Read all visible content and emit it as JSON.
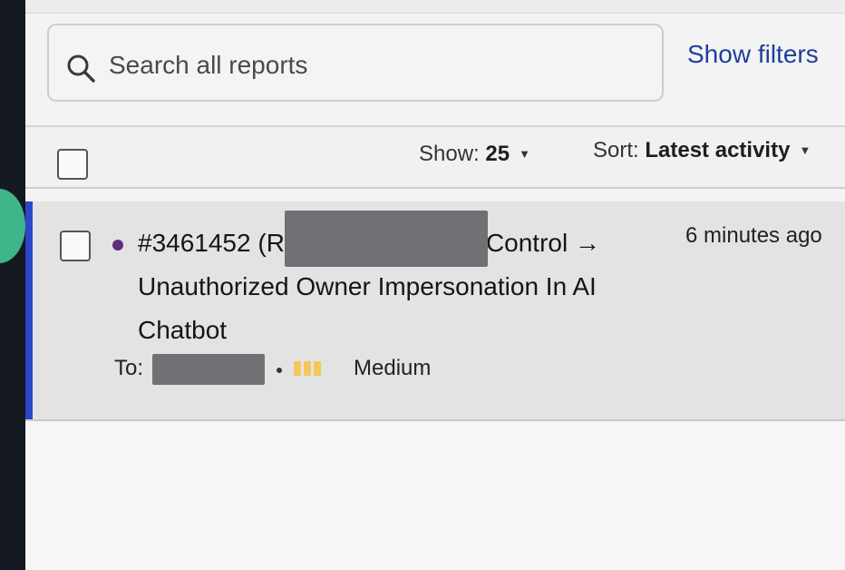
{
  "search": {
    "placeholder": "Search all reports",
    "value": ""
  },
  "filters": {
    "show_filters_label": "Show filters"
  },
  "toolbar": {
    "show_label": "Show:",
    "show_value": "25",
    "sort_label": "Sort:",
    "sort_value": "Latest activity"
  },
  "report": {
    "title": "#3461452 •••RT: Broken Access Control → Unauthorized Owner Impersonation In AI Chatbot",
    "title_prefix": "#3461452 (",
    "title_suffix": "RT: Broken Access Control → Unauthorized Owner Impersonation In AI Chatbot",
    "time": "6 minutes ago",
    "to_label": "To:",
    "severity": "Medium",
    "status_color": "#5c2e7e"
  },
  "colors": {
    "accent": "#2b46c9",
    "link": "#1f3f9a",
    "severity": "#f3c85a"
  },
  "icons": [
    "search-icon",
    "chevron-down-icon"
  ]
}
